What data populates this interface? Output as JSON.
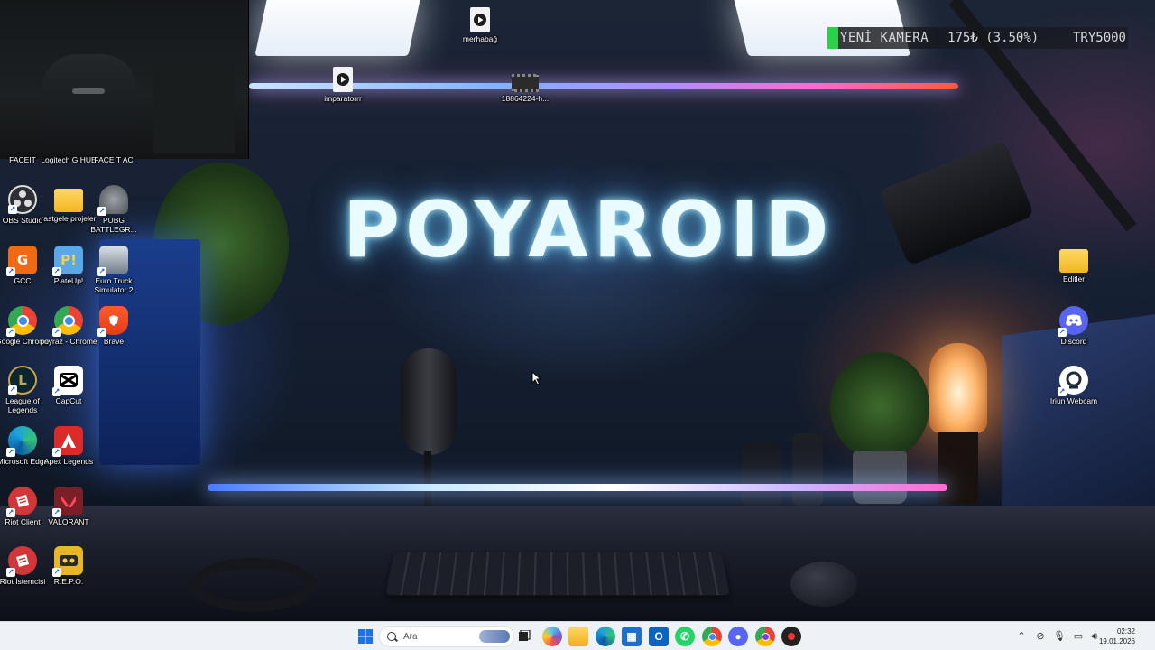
{
  "wallpaper": {
    "title": "POYAROID"
  },
  "ticker": {
    "name": "YENİ KAMERA",
    "price": "175₺ (3.50%)",
    "goal": "TRY5000",
    "accent": "#27d447",
    "progress_percent": 3.5
  },
  "desktop_icons": {
    "top": [
      {
        "label": "merhabağ",
        "icon": "video-file-icon"
      },
      {
        "label": "imparatorrr",
        "icon": "video-file-icon"
      },
      {
        "label": "18864224-h...",
        "icon": "video-thumbnail-icon"
      }
    ],
    "left": [
      {
        "label": "FACEIT",
        "icon": "faceit-icon"
      },
      {
        "label": "Logitech G HUB",
        "icon": "logitech-icon"
      },
      {
        "label": "FACEIT AC",
        "icon": "faceit-ac-icon"
      },
      {
        "label": "OBS Studio",
        "icon": "obs-icon"
      },
      {
        "label": "rastgele projeler",
        "icon": "folder-icon"
      },
      {
        "label": "PUBG BATTLEGR...",
        "icon": "pubg-icon"
      },
      {
        "label": "GCC",
        "icon": "gcc-icon"
      },
      {
        "label": "PlateUp!",
        "icon": "plateup-icon"
      },
      {
        "label": "Euro Truck Simulator 2",
        "icon": "truck-icon"
      },
      {
        "label": "Google Chrome",
        "icon": "chrome-icon"
      },
      {
        "label": "poyraz - Chrome",
        "icon": "chrome-profile-icon"
      },
      {
        "label": "Brave",
        "icon": "brave-icon"
      },
      {
        "label": "League of Legends",
        "icon": "league-icon"
      },
      {
        "label": "CapCut",
        "icon": "capcut-icon"
      },
      {
        "label": "Microsoft Edge",
        "icon": "edge-icon"
      },
      {
        "label": "Apex Legends",
        "icon": "apex-icon"
      },
      {
        "label": "Riot Client",
        "icon": "riot-icon"
      },
      {
        "label": "VALORANT",
        "icon": "valorant-icon"
      },
      {
        "label": "Riot İstemcisi",
        "icon": "riot-icon"
      },
      {
        "label": "R.E.P.O.",
        "icon": "repo-icon"
      }
    ],
    "right": [
      {
        "label": "Editler",
        "icon": "folder-icon"
      },
      {
        "label": "Discord",
        "icon": "discord-icon"
      },
      {
        "label": "Iriun Webcam",
        "icon": "iriun-icon"
      }
    ]
  },
  "taskbar": {
    "search_placeholder": "Ara",
    "apps": [
      "start-icon",
      "task-view-icon",
      "copilot-icon",
      "file-explorer-icon",
      "edge-icon",
      "store-icon",
      "outlook-icon",
      "whatsapp-icon",
      "chrome-icon",
      "discord-icon",
      "chrome-profile-icon",
      "riot-icon"
    ],
    "clock": {
      "time": "02:32",
      "date": "19.01.2026"
    }
  }
}
